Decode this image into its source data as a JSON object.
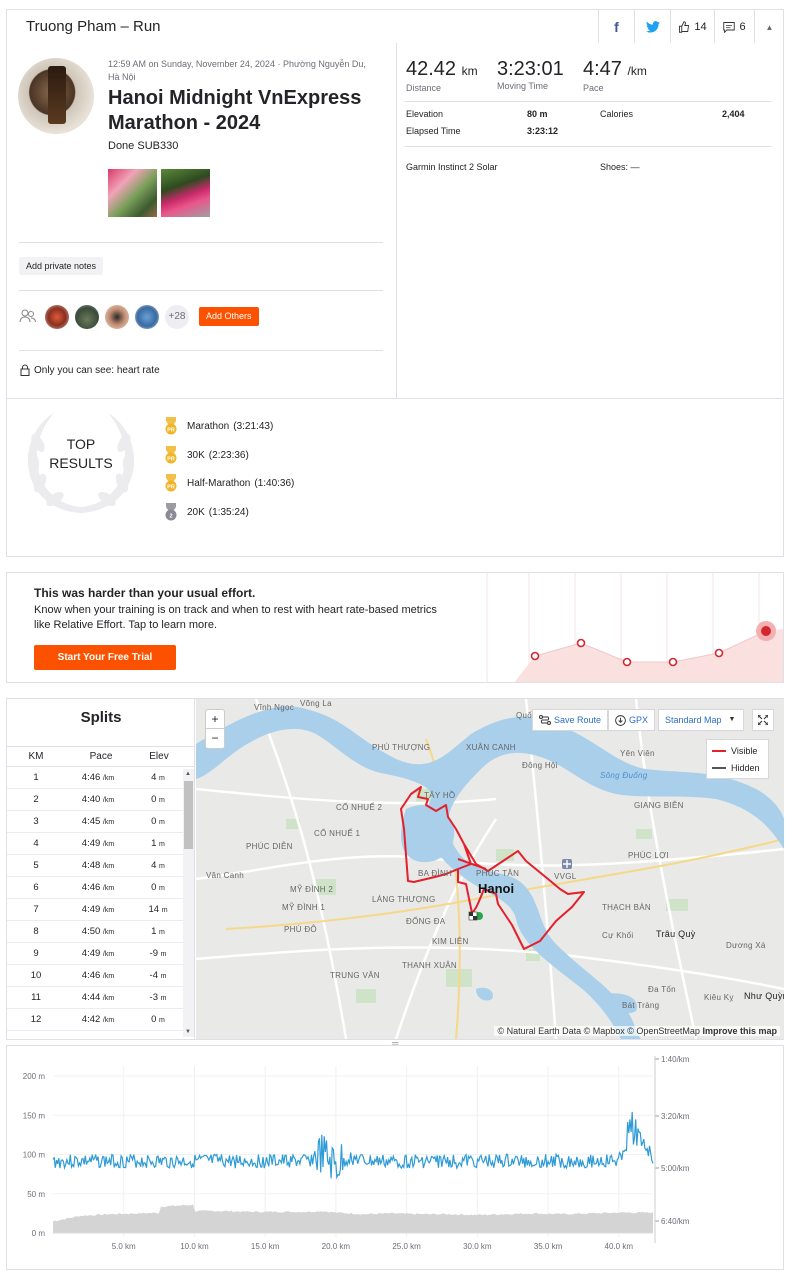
{
  "header": {
    "title": "Truong Pham – Run",
    "kudos_count": "14",
    "comments_count": "6"
  },
  "activity": {
    "meta": "12:59 AM on Sunday, November 24, 2024 · Phường Nguyễn Du, Hà Nội",
    "name": "Hanoi Midnight VnExpress Marathon - 2024",
    "description": "Done SUB330",
    "add_notes_label": "Add private notes",
    "more_kudoers": "+28",
    "add_others_label": "Add Others",
    "privacy_text": "Only you can see: heart rate"
  },
  "stats": {
    "distance": {
      "value": "42.42",
      "unit": "km",
      "label": "Distance"
    },
    "moving_time": {
      "value": "3:23:01",
      "label": "Moving Time"
    },
    "pace": {
      "value": "4:47",
      "unit": "/km",
      "label": "Pace"
    },
    "elevation": {
      "label": "Elevation",
      "value": "80 m"
    },
    "calories": {
      "label": "Calories",
      "value": "2,404"
    },
    "elapsed": {
      "label": "Elapsed Time",
      "value": "3:23:12"
    },
    "device": "Garmin Instinct 2 Solar",
    "shoes": "Shoes: —"
  },
  "top_results": {
    "label_line1": "TOP",
    "label_line2": "RESULTS",
    "items": [
      {
        "name": "Marathon",
        "time": "(3:21:43)",
        "medal": "PR",
        "color": "#f0b429"
      },
      {
        "name": "30K",
        "time": "(2:23:36)",
        "medal": "PR",
        "color": "#f0b429"
      },
      {
        "name": "Half-Marathon",
        "time": "(1:40:36)",
        "medal": "PR",
        "color": "#f0b429"
      },
      {
        "name": "20K",
        "time": "(1:35:24)",
        "medal": "2",
        "color": "#8a8a94"
      }
    ]
  },
  "effort": {
    "title": "This was harder than your usual effort.",
    "body": "Know when your training is on track and when to rest with heart rate-based metrics like Relative Effort. Tap to learn more.",
    "cta": "Start Your Free Trial"
  },
  "splits": {
    "title": "Splits",
    "headers": [
      "KM",
      "Pace",
      "Elev"
    ],
    "pace_unit": "/km",
    "elev_unit": "m",
    "rows": [
      {
        "km": "1",
        "pace": "4:46",
        "elev": "4"
      },
      {
        "km": "2",
        "pace": "4:40",
        "elev": "0"
      },
      {
        "km": "3",
        "pace": "4:45",
        "elev": "0"
      },
      {
        "km": "4",
        "pace": "4:49",
        "elev": "1"
      },
      {
        "km": "5",
        "pace": "4:48",
        "elev": "4"
      },
      {
        "km": "6",
        "pace": "4:46",
        "elev": "0"
      },
      {
        "km": "7",
        "pace": "4:49",
        "elev": "14"
      },
      {
        "km": "8",
        "pace": "4:50",
        "elev": "1"
      },
      {
        "km": "9",
        "pace": "4:49",
        "elev": "-9"
      },
      {
        "km": "10",
        "pace": "4:46",
        "elev": "-4"
      },
      {
        "km": "11",
        "pace": "4:44",
        "elev": "-3"
      },
      {
        "km": "12",
        "pace": "4:42",
        "elev": "0"
      }
    ]
  },
  "map": {
    "save_route": "Save Route",
    "gpx": "GPX",
    "map_style": "Standard Map",
    "legend_visible": "Visible",
    "legend_hidden": "Hidden",
    "attribution": "© Natural Earth Data © Mapbox © OpenStreetMap",
    "attribution_link": "Improve this map",
    "city_label": "Hanoi",
    "zoom_in": "+",
    "zoom_out": "−",
    "labels": [
      "Vĩnh Ngọc",
      "Quốc",
      "Võng La",
      "PHÚ THƯỢNG",
      "XUÂN CANH",
      "Đông Hội",
      "Yên Viên",
      "Sông Đuống",
      "CỔ NHUẾ 2",
      "CỔ NHUẾ 1",
      "PHÚC DIỄN",
      "GIANG BIÊN",
      "PHÚC LỢI",
      "BA ĐÌNH",
      "PHÚC TÂN",
      "VVGL",
      "Vân Canh",
      "MỸ ĐÌNH 2",
      "MỸ ĐÌNH 1",
      "LÁNG THƯỢNG",
      "ĐỐNG ĐA",
      "THẠCH BÀN",
      "PHÚ ĐÔ",
      "KIM LIÊN",
      "Trâu Quỳ",
      "THANH XUÂN",
      "TRUNG VĂN",
      "Dương Xá",
      "Kiêu Kỵ",
      "Như Quỳnh",
      "Bát Tràng",
      "Đa Tốn",
      "TÂY HỒ",
      "Cự Khối"
    ]
  },
  "elevation_chart": {
    "y_left_ticks": [
      "200 m",
      "150 m",
      "100 m",
      "50 m",
      "0 m"
    ],
    "y_right_ticks": [
      "1:40/km",
      "3:20/km",
      "5:00/km",
      "6:40/km"
    ],
    "x_ticks": [
      "5.0 km",
      "10.0 km",
      "15.0 km",
      "20.0 km",
      "25.0 km",
      "30.0 km",
      "35.0 km",
      "40.0 km"
    ],
    "colors": {
      "pace": "#2e9bd6",
      "elevation": "#cfcfcf"
    }
  },
  "chart_data": {
    "type": "area",
    "x_label": "",
    "xlim": [
      0,
      42.42
    ],
    "ylim": [
      0,
      200
    ],
    "series": [
      {
        "name": "",
        "x": [
          0,
          2,
          4,
          6,
          8,
          10,
          12,
          14,
          16,
          18,
          19,
          20,
          22,
          24,
          26,
          28,
          30,
          32,
          34,
          36,
          38,
          40,
          41,
          42.42
        ],
        "y": [
          15,
          22,
          24,
          25,
          26,
          28,
          28,
          27,
          27,
          27,
          28,
          26,
          24,
          25,
          24,
          24,
          23,
          24,
          25,
          24,
          25,
          26,
          26,
          26
        ]
      },
      {
        "name": "",
        "x": [
          0,
          2,
          4,
          6,
          8,
          10,
          12,
          14,
          16,
          18,
          19,
          20,
          21,
          22,
          24,
          26,
          28,
          30,
          32,
          34,
          36,
          38,
          40,
          41,
          42.42
        ],
        "y": [
          "4:48",
          "4:47",
          "4:47",
          "4:47",
          "4:48",
          "4:47",
          "4:47",
          "4:47",
          "4:47",
          "4:47",
          "4:35",
          "5:00",
          "4:40",
          "4:47",
          "4:48",
          "4:47",
          "4:47",
          "4:47",
          "4:47",
          "4:47",
          "4:47",
          "4:47",
          "4:47",
          "3:40",
          "4:40"
        ]
      }
    ]
  }
}
